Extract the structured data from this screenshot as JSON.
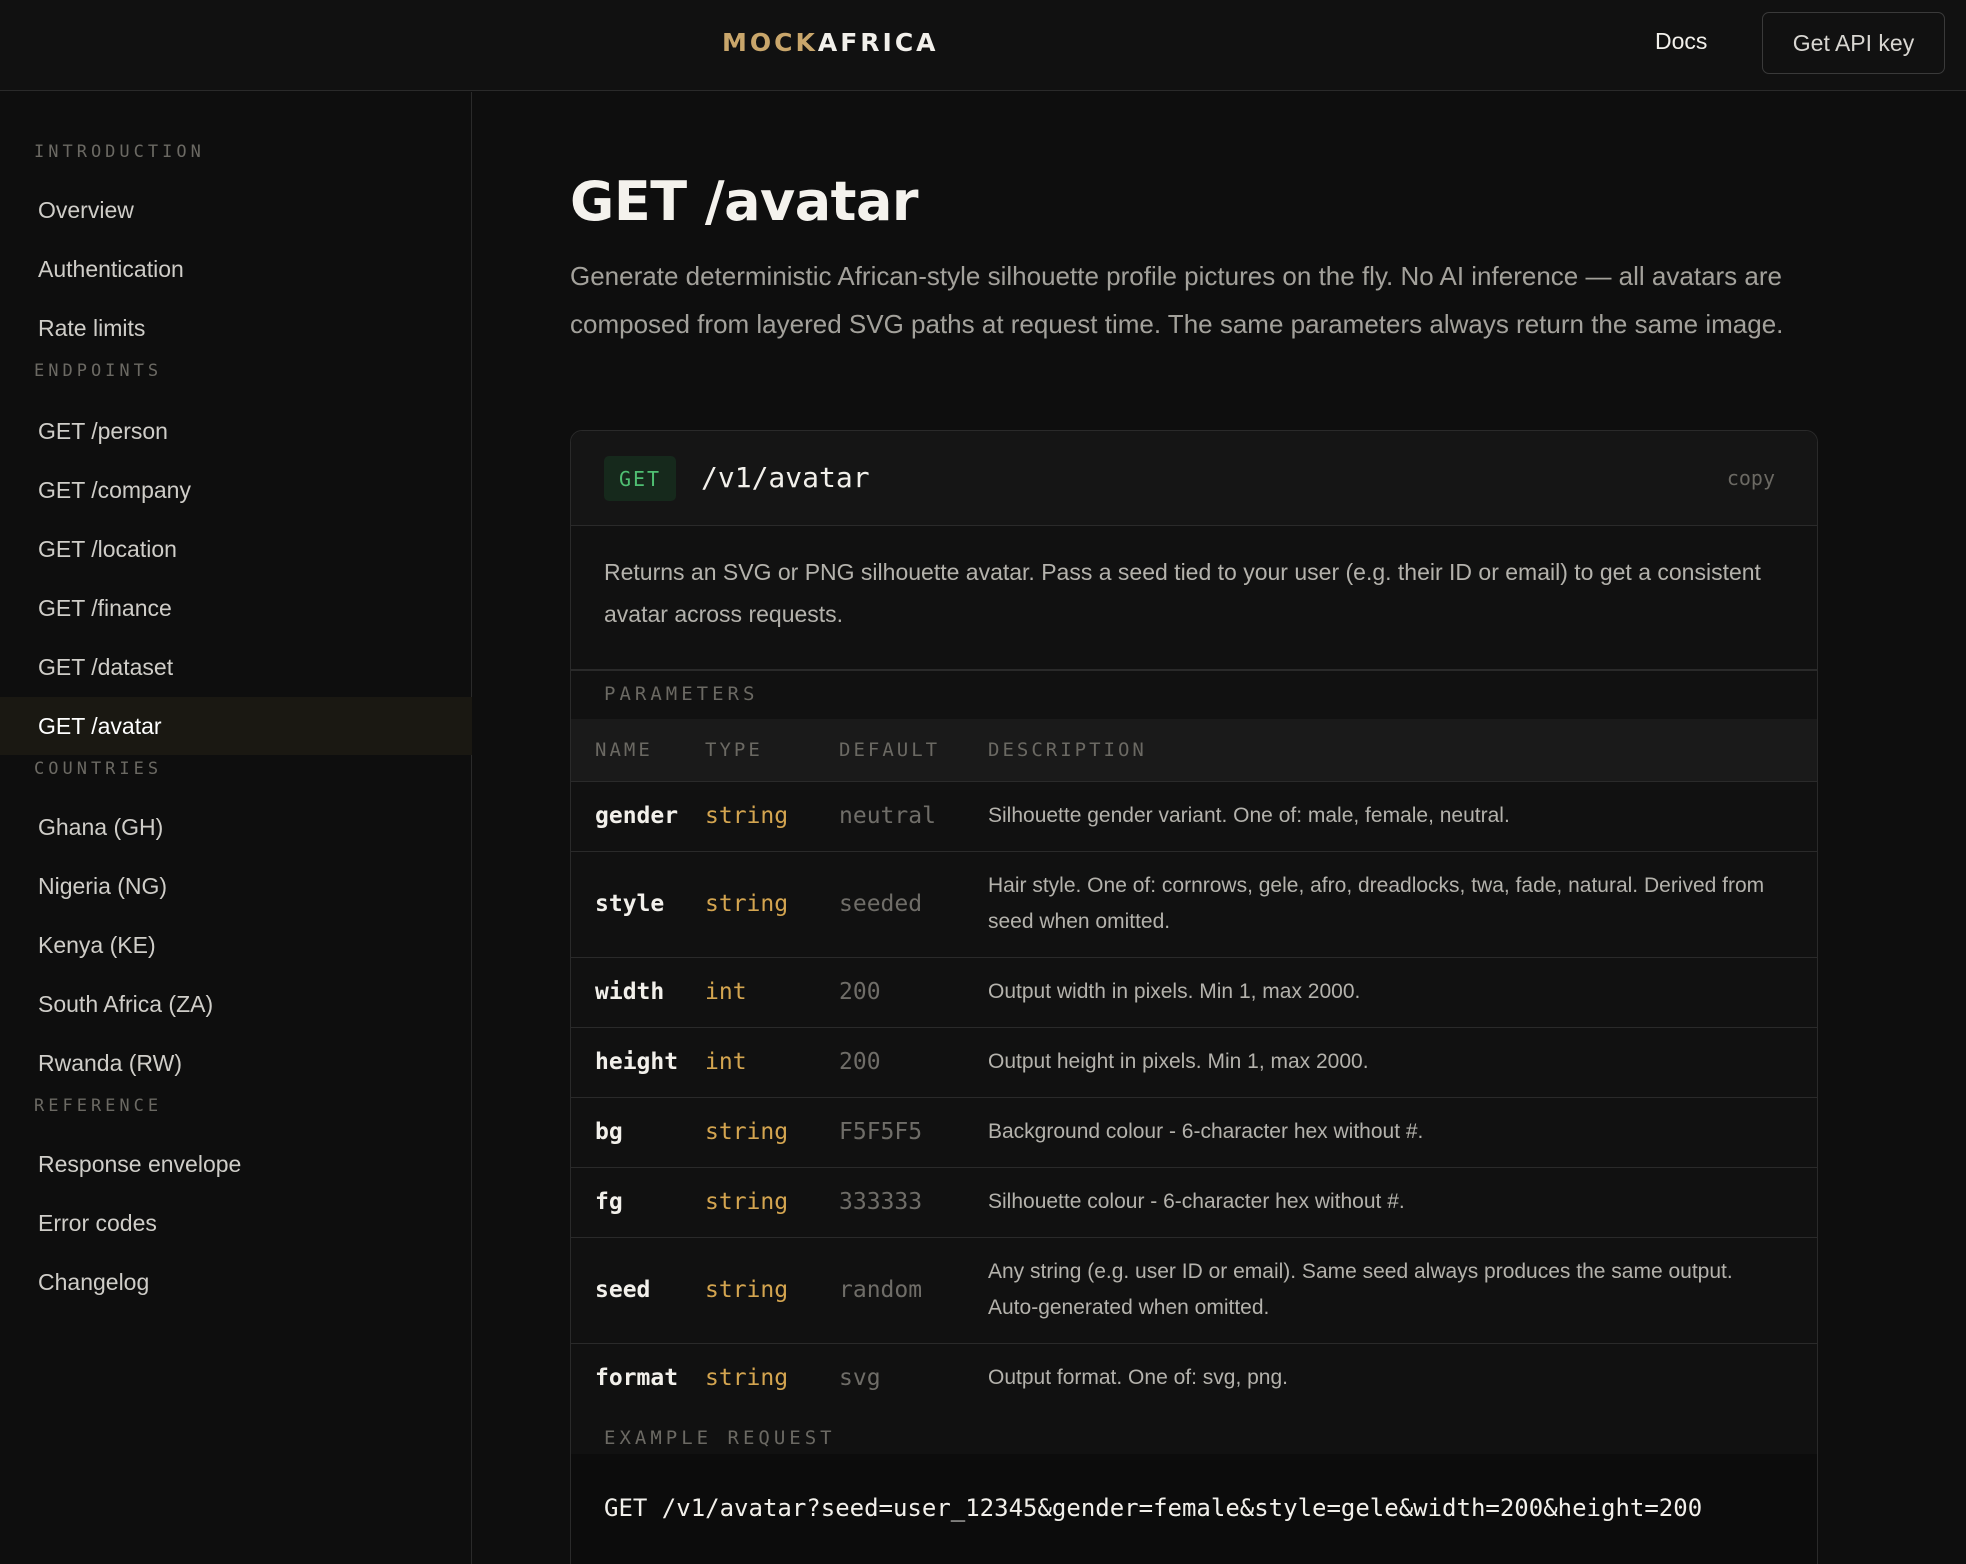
{
  "header": {
    "logo_part1": "MOCK",
    "logo_part2": "AFRICA",
    "docs_label": "Docs",
    "api_key_label": "Get API key"
  },
  "sidebar": {
    "sections": [
      {
        "title": "INTRODUCTION",
        "items": [
          "Overview",
          "Authentication",
          "Rate limits"
        ]
      },
      {
        "title": "ENDPOINTS",
        "items": [
          "GET /person",
          "GET /company",
          "GET /location",
          "GET /finance",
          "GET /dataset",
          "GET /avatar"
        ]
      },
      {
        "title": "COUNTRIES",
        "items": [
          "Ghana (GH)",
          "Nigeria (NG)",
          "Kenya (KE)",
          "South Africa (ZA)",
          "Rwanda (RW)"
        ]
      },
      {
        "title": "REFERENCE",
        "items": [
          "Response envelope",
          "Error codes",
          "Changelog"
        ]
      }
    ],
    "active_item": "GET /avatar"
  },
  "main": {
    "title": "GET /avatar",
    "description": "Generate deterministic African-style silhouette profile pictures on the fly. No AI inference — all avatars are composed from layered SVG paths at request time. The same parameters always return the same image.",
    "endpoint": {
      "method": "GET",
      "path": "/v1/avatar",
      "copy_label": "copy",
      "description": "Returns an SVG or PNG silhouette avatar. Pass a seed tied to your user (e.g. their ID or email) to get a consistent avatar across requests."
    },
    "parameters_label": "PARAMETERS",
    "columns": [
      "NAME",
      "TYPE",
      "DEFAULT",
      "DESCRIPTION"
    ],
    "params": [
      {
        "name": "gender",
        "type": "string",
        "default": "neutral",
        "description": "Silhouette gender variant. One of: male, female, neutral."
      },
      {
        "name": "style",
        "type": "string",
        "default": "seeded",
        "description": "Hair style. One of: cornrows, gele, afro, dreadlocks, twa, fade, natural. Derived from seed when omitted."
      },
      {
        "name": "width",
        "type": "int",
        "default": "200",
        "description": "Output width in pixels. Min 1, max 2000."
      },
      {
        "name": "height",
        "type": "int",
        "default": "200",
        "description": "Output height in pixels. Min 1, max 2000."
      },
      {
        "name": "bg",
        "type": "string",
        "default": "F5F5F5",
        "description": "Background colour - 6-character hex without #."
      },
      {
        "name": "fg",
        "type": "string",
        "default": "333333",
        "description": "Silhouette colour - 6-character hex without #."
      },
      {
        "name": "seed",
        "type": "string",
        "default": "random",
        "description": "Any string (e.g. user ID or email). Same seed always produces the same output. Auto-generated when omitted."
      },
      {
        "name": "format",
        "type": "string",
        "default": "svg",
        "description": "Output format. One of: svg, png."
      }
    ],
    "example_label": "EXAMPLE REQUEST",
    "example_request": "GET /v1/avatar?seed=user_12345&gender=female&style=gele&width=200&height=200"
  },
  "colors": {
    "accent_gold": "#c9a66b",
    "type_color": "#d4a550",
    "method_green": "#4fbf72"
  }
}
